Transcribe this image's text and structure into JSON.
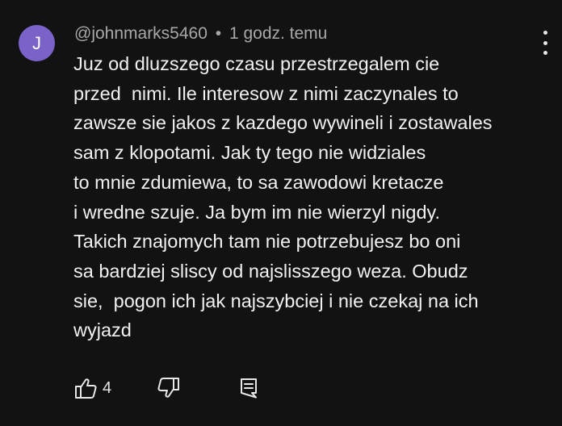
{
  "comment": {
    "avatar_letter": "J",
    "avatar_color": "#7b62c9",
    "author": "@johnmarks5460",
    "separator": "•",
    "time": "1 godz. temu",
    "lines": [
      "Juz od dluzszego czasu przestrzegalem cie",
      "przed  nimi. Ile interesow z nimi zaczynales to",
      "zawsze sie jakos z kazdego wywineli i zostawales",
      "sam z klopotami. Jak ty tego nie widziales",
      "to mnie zdumiewa, to sa zawodowi kretacze",
      "i wredne szuje. Ja bym im nie wierzyl nigdy.",
      "Takich znajomych tam nie potrzebujesz bo oni",
      "sa bardziej sliscy od najslisszego weza. Obudz",
      "sie,  pogon ich jak najszybciej i nie czekaj na ich",
      "wyjazd"
    ],
    "like_count": "4",
    "icons": {
      "like": "thumbs-up-icon",
      "dislike": "thumbs-down-icon",
      "reply": "reply-icon",
      "menu": "more-vertical-icon"
    }
  }
}
